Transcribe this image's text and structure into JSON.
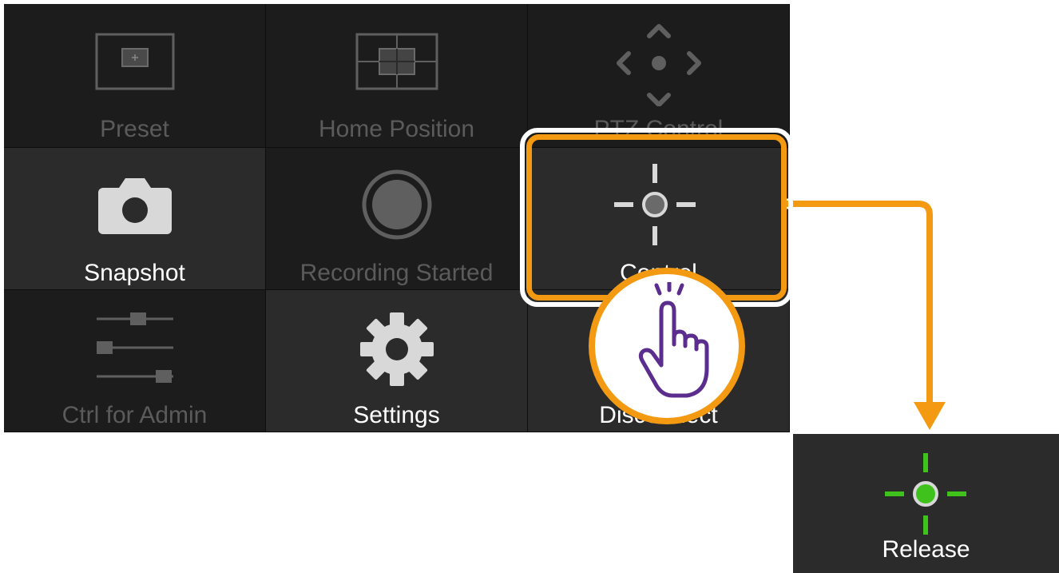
{
  "grid": {
    "preset_label": "Preset",
    "home_position_label": "Home Position",
    "ptz_control_label": "PTZ Control",
    "snapshot_label": "Snapshot",
    "recording_label": "Recording Started",
    "control_label": "Control",
    "ctrl_for_admin_label": "Ctrl for Admin",
    "settings_label": "Settings",
    "disconnect_label": "Disconnect"
  },
  "result": {
    "release_label": "Release"
  },
  "icons": {
    "preset": "preset-frame-icon",
    "home_position": "home-position-grid-icon",
    "ptz": "ptz-arrows-icon",
    "snapshot": "camera-icon",
    "recording": "record-icon",
    "control": "crosshair-icon",
    "ctrl_for_admin": "sliders-icon",
    "settings": "gear-icon",
    "tap": "tap-hand-icon",
    "release": "crosshair-active-icon"
  },
  "colors": {
    "highlight": "#f39a12",
    "hand": "#5b2d8e",
    "active_green": "#3fc21c",
    "tile_lit": "#2b2b2b",
    "tile_dim": "#1c1c1c"
  }
}
